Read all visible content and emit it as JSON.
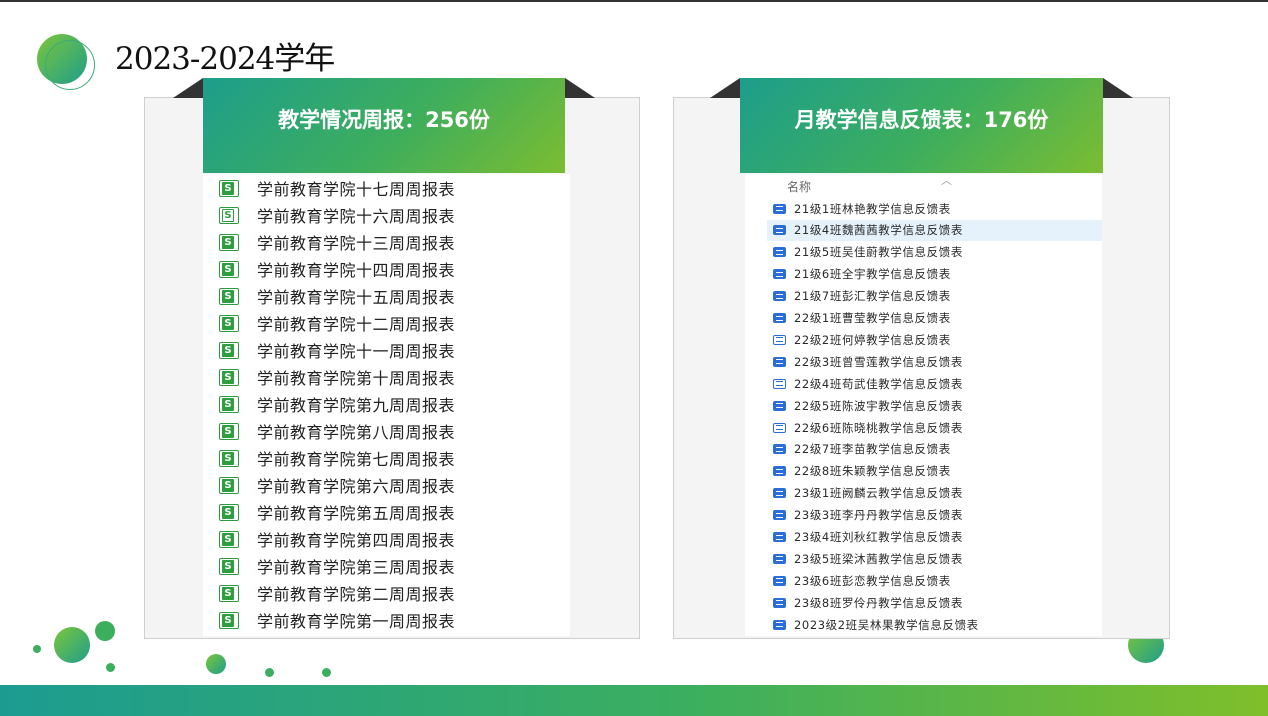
{
  "page": {
    "title": "2023-2024学年"
  },
  "colors": {
    "accent_green": "#3eae5c",
    "accent_teal": "#1d9e8c",
    "accent_lime": "#7cbd31"
  },
  "left_panel": {
    "ribbon_label": "教学情况周报：256份",
    "file_icon": "spreadsheet-s-icon",
    "items": [
      "学前教育学院十七周周报表",
      "学前教育学院十六周周报表",
      "学前教育学院十三周周报表",
      "学前教育学院十四周周报表",
      "学前教育学院十五周周报表",
      "学前教育学院十二周周报表",
      "学前教育学院十一周周报表",
      "学前教育学院第十周周报表",
      "学前教育学院第九周周报表",
      "学前教育学院第八周周报表",
      "学前教育学院第七周周报表",
      "学前教育学院第六周周报表",
      "学前教育学院第五周周报表",
      "学前教育学院第四周周报表",
      "学前教育学院第三周周报表",
      "学前教育学院第二周周报表",
      "学前教育学院第一周周报表"
    ]
  },
  "right_panel": {
    "ribbon_label": "月教学信息反馈表：176份",
    "column_header": "名称",
    "sort_icon": "chevron-up-icon",
    "file_icon": "word-doc-icon",
    "selected_index": 1,
    "items": [
      "21级1班林艳教学信息反馈表",
      "21级4班魏茜茜教学信息反馈表",
      "21级5班吴佳蔚教学信息反馈表",
      "21级6班全宇教学信息反馈表",
      "21级7班彭汇教学信息反馈表",
      "22级1班曹莹教学信息反馈表",
      "22级2班何婷教学信息反馈表",
      "22级3班曾雪莲教学信息反馈表",
      "22级4班苟武佳教学信息反馈表",
      "22级5班陈波宇教学信息反馈表",
      "22级6班陈晓桃教学信息反馈表",
      "22级7班李苗教学信息反馈表",
      "22级8班朱颖教学信息反馈表",
      "23级1班阙麟云教学信息反馈表",
      "23级3班李丹丹教学信息反馈表",
      "23级4班刘秋红教学信息反馈表",
      "23级5班梁沐茜教学信息反馈表",
      "23级6班彭恋教学信息反馈表",
      "23级8班罗伶丹教学信息反馈表",
      "2023级2班吴林果教学信息反馈表"
    ]
  }
}
